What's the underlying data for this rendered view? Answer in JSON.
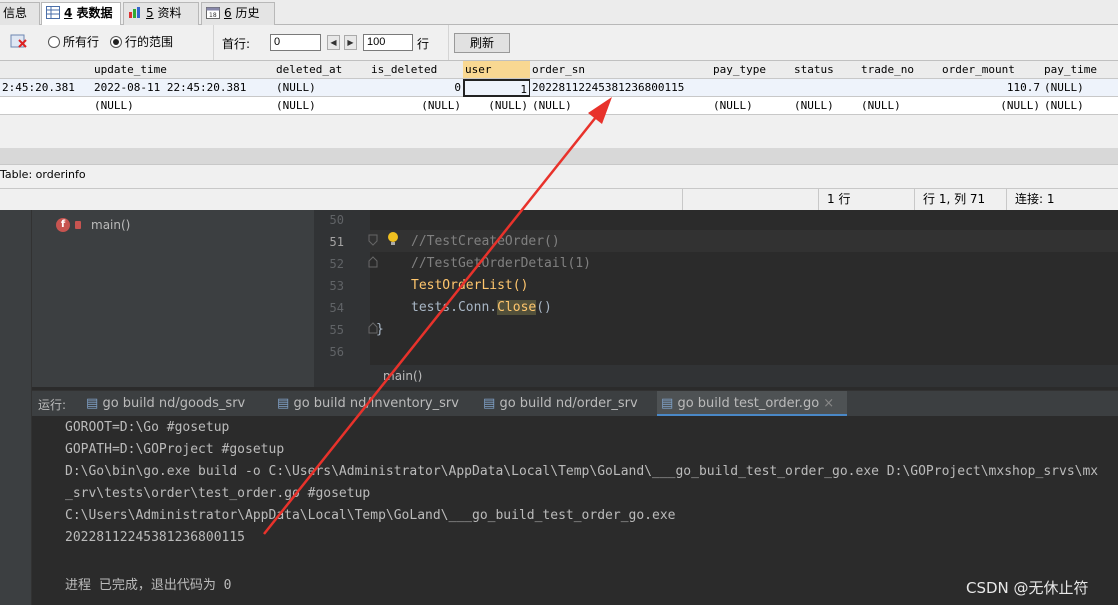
{
  "tabs": [
    {
      "label": "信息"
    },
    {
      "number": "4",
      "label": "表数据"
    },
    {
      "number": "5",
      "label": "资料"
    },
    {
      "number": "6",
      "label": "历史"
    }
  ],
  "toolbar": {
    "radio_all_rows": "所有行",
    "radio_row_range": "行的范围",
    "first_row_label": "首行:",
    "first_row_value": "0",
    "rows_value": "100",
    "rows_label": "行",
    "refresh_label": "刷新"
  },
  "grid": {
    "columns": [
      "update_time",
      "deleted_at",
      "is_deleted",
      "user",
      "order_sn",
      "pay_type",
      "status",
      "trade_no",
      "order_mount",
      "pay_time"
    ],
    "row1": {
      "partial": "2:45:20.381",
      "update_time": "2022-08-11 22:45:20.381",
      "deleted_at": "(NULL)",
      "is_deleted": "0",
      "user": "1",
      "order_sn": "20228112245381236800115",
      "pay_type": "",
      "status": "",
      "trade_no": "",
      "order_mount": "110.7",
      "pay_time": "(NULL)"
    },
    "row2": {
      "partial": "",
      "update_time": "(NULL)",
      "deleted_at": "(NULL)",
      "is_deleted": "(NULL)",
      "user": "(NULL)",
      "order_sn": "(NULL)",
      "pay_type": "(NULL)",
      "status": "(NULL)",
      "trade_no": "(NULL)",
      "order_mount": "(NULL)",
      "pay_time": "(NULL)"
    }
  },
  "table_info": "Table: orderinfo",
  "status": {
    "rows": "1 行",
    "position": "行 1, 列 71",
    "connections": "连接: 1"
  },
  "structure": {
    "item": "main()"
  },
  "editor": {
    "lines": [
      {
        "num": "50",
        "text": ""
      },
      {
        "num": "51",
        "text": "//TestCreateOrder()"
      },
      {
        "num": "52",
        "text": "//TestGetOrderDetail(1)"
      },
      {
        "num": "53",
        "text": "TestOrderList()"
      },
      {
        "num": "54",
        "text_a": "tests.Conn.",
        "text_b": "Close",
        "text_c": "()"
      },
      {
        "num": "55",
        "text": "}"
      },
      {
        "num": "56",
        "text": ""
      }
    ],
    "breadcrumb": "main()"
  },
  "run": {
    "label": "运行:",
    "tabs": [
      "go build nd/goods_srv",
      "go build nd/inventory_srv",
      "go build nd/order_srv",
      "go build test_order.go"
    ]
  },
  "console": [
    "GOROOT=D:\\Go #gosetup",
    "GOPATH=D:\\GOProject #gosetup",
    "D:\\Go\\bin\\go.exe build -o C:\\Users\\Administrator\\AppData\\Local\\Temp\\GoLand\\___go_build_test_order_go.exe D:\\GOProject\\mxshop_srvs\\mx",
    "_srv\\tests\\order\\test_order.go #gosetup",
    "C:\\Users\\Administrator\\AppData\\Local\\Temp\\GoLand\\___go_build_test_order_go.exe",
    "20228112245381236800115",
    "",
    "进程 已完成，退出代码为 0"
  ],
  "watermark": "CSDN @无休止符",
  "colors": {
    "arrow": "#e8322b",
    "accent": "#4a88c7"
  }
}
